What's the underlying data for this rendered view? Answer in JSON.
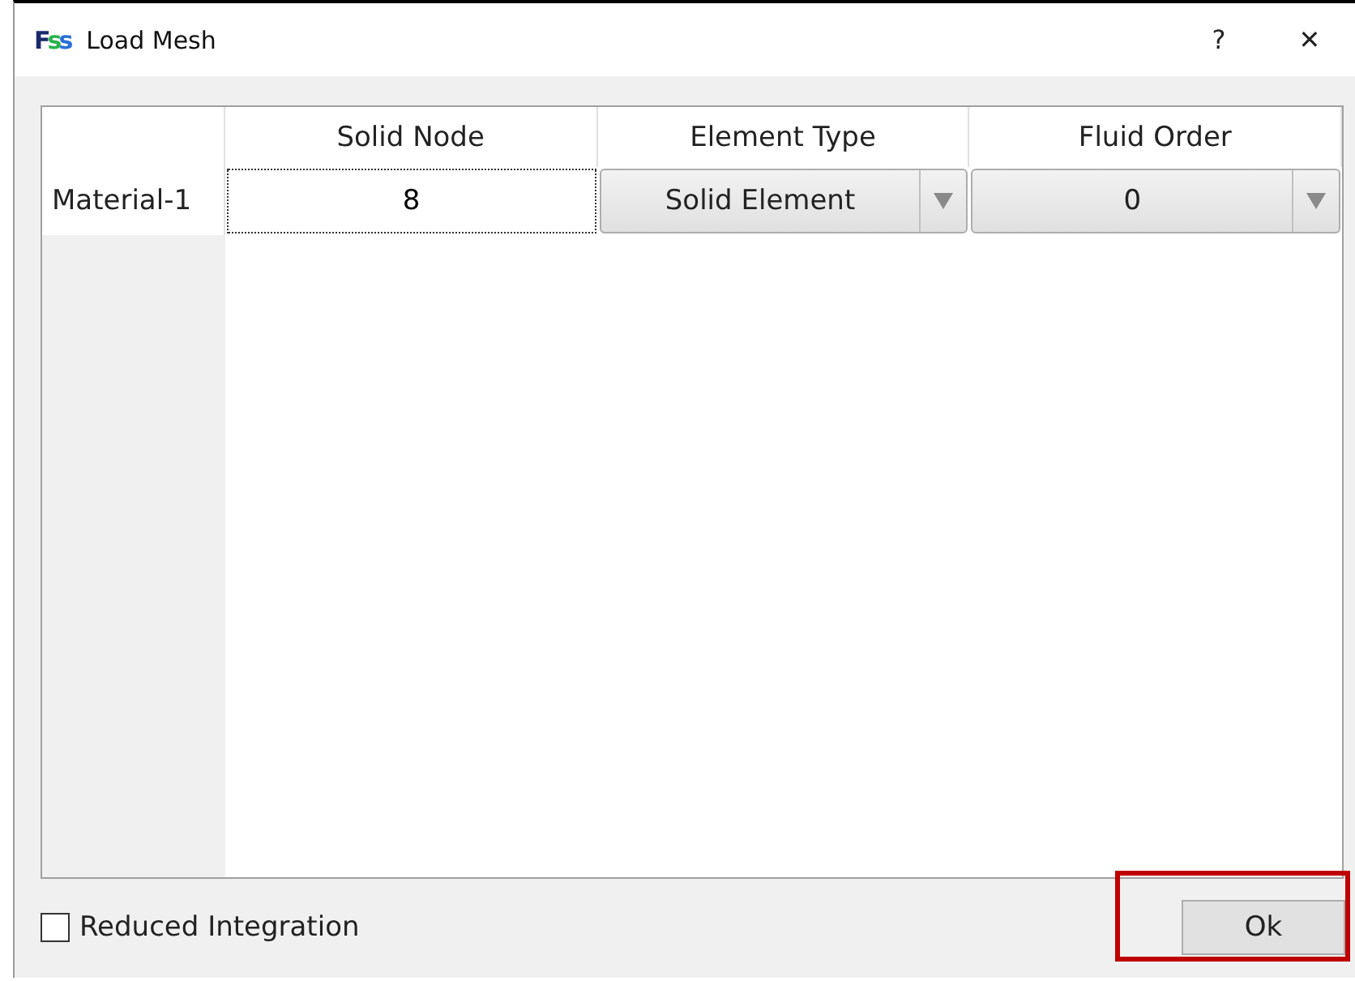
{
  "window": {
    "logo": "Fss",
    "title": "Load Mesh",
    "help": "?",
    "close": "✕"
  },
  "table": {
    "columns": [
      "Solid Node",
      "Element Type",
      "Fluid Order"
    ],
    "rows": [
      {
        "header": "Material-1",
        "cells": [
          {
            "kind": "text",
            "value": "8",
            "focused": true
          },
          {
            "kind": "combo",
            "value": "Solid Element"
          },
          {
            "kind": "combo",
            "value": "0"
          }
        ]
      }
    ]
  },
  "reduced_integration": {
    "label": "Reduced Integration",
    "checked": false
  },
  "buttons": [
    {
      "label": "Ok",
      "highlighted": true
    }
  ]
}
